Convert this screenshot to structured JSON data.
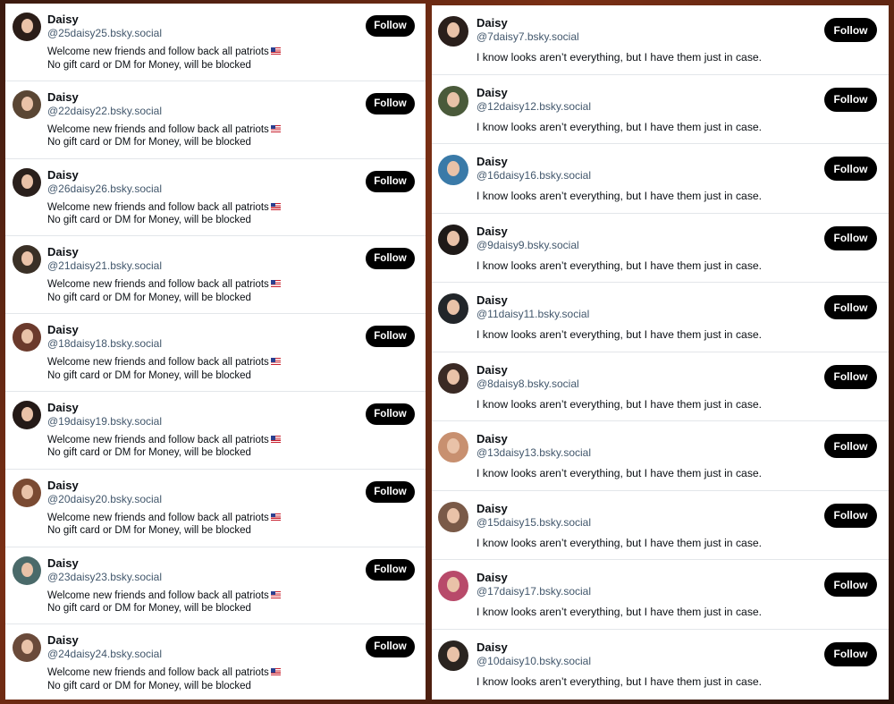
{
  "left_column": {
    "users": [
      {
        "name": "Daisy",
        "handle": "@25daisy25.bsky.social",
        "bio_line1": "Welcome new friends and follow back all patriots",
        "bio_line2": "No gift card or DM for Money, will be blocked",
        "follow_label": "Follow",
        "avatar_hair": "#2b1d18"
      },
      {
        "name": "Daisy",
        "handle": "@22daisy22.bsky.social",
        "bio_line1": "Welcome new friends and follow back all patriots",
        "bio_line2": "No gift card or DM for Money, will be blocked",
        "follow_label": "Follow",
        "avatar_hair": "#5a4634"
      },
      {
        "name": "Daisy",
        "handle": "@26daisy26.bsky.social",
        "bio_line1": "Welcome new friends and follow back all patriots",
        "bio_line2": "No gift card or DM for Money, will be blocked",
        "follow_label": "Follow",
        "avatar_hair": "#2a201c"
      },
      {
        "name": "Daisy",
        "handle": "@21daisy21.bsky.social",
        "bio_line1": "Welcome new friends and follow back all patriots",
        "bio_line2": "No gift card or DM for Money, will be blocked",
        "follow_label": "Follow",
        "avatar_hair": "#3a3026"
      },
      {
        "name": "Daisy",
        "handle": "@18daisy18.bsky.social",
        "bio_line1": "Welcome new friends and follow back all patriots",
        "bio_line2": "No gift card or DM for Money, will be blocked",
        "follow_label": "Follow",
        "avatar_hair": "#6b3a2c"
      },
      {
        "name": "Daisy",
        "handle": "@19daisy19.bsky.social",
        "bio_line1": "Welcome new friends and follow back all patriots",
        "bio_line2": "No gift card or DM for Money, will be blocked",
        "follow_label": "Follow",
        "avatar_hair": "#241a17"
      },
      {
        "name": "Daisy",
        "handle": "@20daisy20.bsky.social",
        "bio_line1": "Welcome new friends and follow back all patriots",
        "bio_line2": "No gift card or DM for Money, will be blocked",
        "follow_label": "Follow",
        "avatar_hair": "#7a4a32"
      },
      {
        "name": "Daisy",
        "handle": "@23daisy23.bsky.social",
        "bio_line1": "Welcome new friends and follow back all patriots",
        "bio_line2": "No gift card or DM for Money, will be blocked",
        "follow_label": "Follow",
        "avatar_hair": "#4a6a6a"
      },
      {
        "name": "Daisy",
        "handle": "@24daisy24.bsky.social",
        "bio_line1": "Welcome new friends and follow back all patriots",
        "bio_line2": "No gift card or DM for Money, will be blocked",
        "follow_label": "Follow",
        "avatar_hair": "#6a4a3a"
      }
    ]
  },
  "right_column": {
    "users": [
      {
        "name": "Daisy",
        "handle": "@7daisy7.bsky.social",
        "bio": "I know looks aren’t everything, but I have them just in case.",
        "follow_label": "Follow",
        "avatar_hair": "#2a1f1b"
      },
      {
        "name": "Daisy",
        "handle": "@12daisy12.bsky.social",
        "bio": "I know looks aren’t everything, but I have them just in case.",
        "follow_label": "Follow",
        "avatar_hair": "#4a5a3a"
      },
      {
        "name": "Daisy",
        "handle": "@16daisy16.bsky.social",
        "bio": "I know looks aren’t everything, but I have them just in case.",
        "follow_label": "Follow",
        "avatar_hair": "#3a7aa8"
      },
      {
        "name": "Daisy",
        "handle": "@9daisy9.bsky.social",
        "bio": "I know looks aren’t everything, but I have them just in case.",
        "follow_label": "Follow",
        "avatar_hair": "#1f1a18"
      },
      {
        "name": "Daisy",
        "handle": "@11daisy11.bsky.social",
        "bio": "I know looks aren’t everything, but I have them just in case.",
        "follow_label": "Follow",
        "avatar_hair": "#22262a"
      },
      {
        "name": "Daisy",
        "handle": "@8daisy8.bsky.social",
        "bio": "I know looks aren’t everything, but I have them just in case.",
        "follow_label": "Follow",
        "avatar_hair": "#3a2a24"
      },
      {
        "name": "Daisy",
        "handle": "@13daisy13.bsky.social",
        "bio": "I know looks aren’t everything, but I have them just in case.",
        "follow_label": "Follow",
        "avatar_hair": "#c89070"
      },
      {
        "name": "Daisy",
        "handle": "@15daisy15.bsky.social",
        "bio": "I know looks aren’t everything, but I have them just in case.",
        "follow_label": "Follow",
        "avatar_hair": "#7a5a48"
      },
      {
        "name": "Daisy",
        "handle": "@17daisy17.bsky.social",
        "bio": "I know looks aren’t everything, but I have them just in case.",
        "follow_label": "Follow",
        "avatar_hair": "#b84a6a"
      },
      {
        "name": "Daisy",
        "handle": "@10daisy10.bsky.social",
        "bio": "I know looks aren’t everything, but I have them just in case.",
        "follow_label": "Follow",
        "avatar_hair": "#2a2420"
      }
    ]
  }
}
